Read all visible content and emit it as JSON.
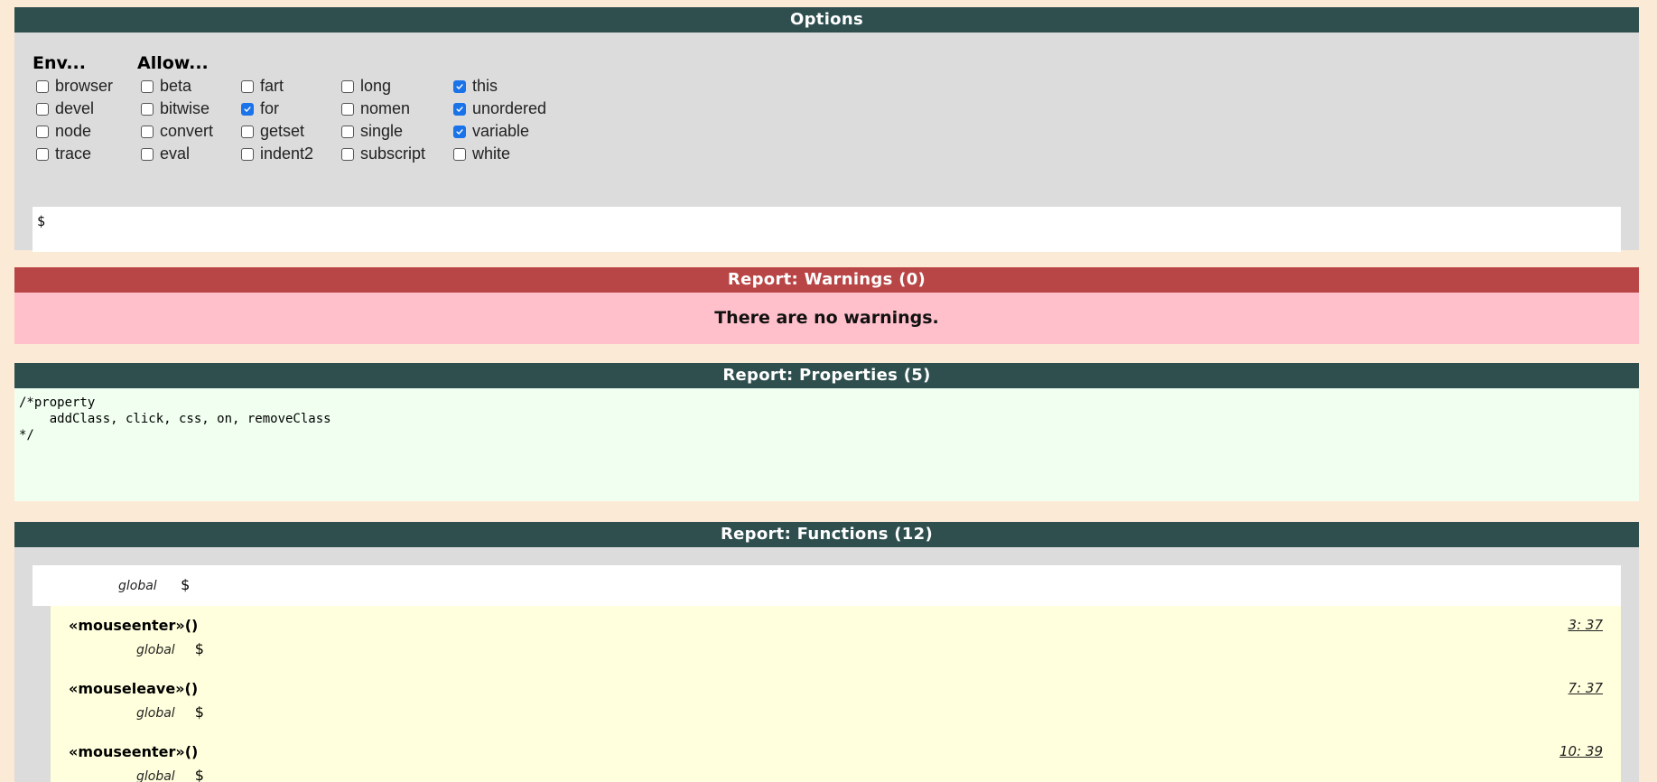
{
  "options": {
    "title": "Options",
    "env": {
      "title": "Env...",
      "items": [
        {
          "label": "browser",
          "checked": false
        },
        {
          "label": "devel",
          "checked": false
        },
        {
          "label": "node",
          "checked": false
        },
        {
          "label": "trace",
          "checked": false
        }
      ]
    },
    "allow": {
      "title": "Allow...",
      "columns": [
        [
          {
            "label": "beta",
            "checked": false
          },
          {
            "label": "bitwise",
            "checked": false
          },
          {
            "label": "convert",
            "checked": false
          },
          {
            "label": "eval",
            "checked": false
          }
        ],
        [
          {
            "label": "fart",
            "checked": false
          },
          {
            "label": "for",
            "checked": true
          },
          {
            "label": "getset",
            "checked": false
          },
          {
            "label": "indent2",
            "checked": false
          }
        ],
        [
          {
            "label": "long",
            "checked": false
          },
          {
            "label": "nomen",
            "checked": false
          },
          {
            "label": "single",
            "checked": false
          },
          {
            "label": "subscript",
            "checked": false
          }
        ],
        [
          {
            "label": "this",
            "checked": true
          },
          {
            "label": "unordered",
            "checked": true
          },
          {
            "label": "variable",
            "checked": true
          },
          {
            "label": "white",
            "checked": false
          }
        ]
      ]
    },
    "global_input": "$"
  },
  "warnings": {
    "title": "Report: Warnings (0)",
    "message": "There are no warnings."
  },
  "properties": {
    "title": "Report: Properties (5)",
    "text": "/*property\n    addClass, click, css, on, removeClass\n*/"
  },
  "functions": {
    "title": "Report: Functions (12)",
    "global_label": "global",
    "global_value": "$",
    "items": [
      {
        "name": "«mouseenter»()",
        "location": "3: 37",
        "global_label": "global",
        "global_value": "$"
      },
      {
        "name": "«mouseleave»()",
        "location": "7: 37",
        "global_label": "global",
        "global_value": "$"
      },
      {
        "name": "«mouseenter»()",
        "location": "10: 39",
        "global_label": "global",
        "global_value": "$"
      }
    ]
  },
  "colors": {
    "header_dark": "#2f4f4f",
    "header_red": "#b94646",
    "warnings_bg": "#ffc0cb",
    "properties_bg": "#f0fff0",
    "functions_bg": "#ffffdd",
    "page_bg": "#fbead6",
    "checkbox_checked": "#1a73e8"
  }
}
